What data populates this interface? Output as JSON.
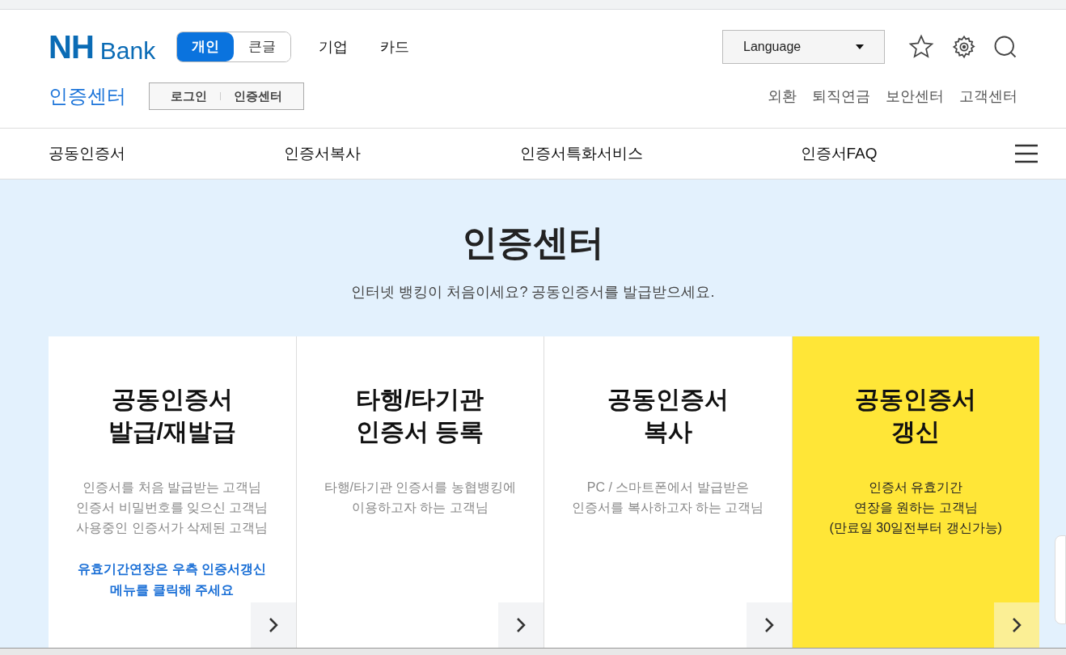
{
  "header": {
    "logo": {
      "mark": "NH",
      "word": "Bank"
    },
    "modes": [
      {
        "label": "개인",
        "selected": true
      },
      {
        "label": "큰글",
        "selected": false
      }
    ],
    "top_links": [
      "기업",
      "카드"
    ],
    "language": {
      "value": "Language"
    },
    "section_title": "인증센터",
    "breadcrumb": [
      "로그인",
      "인증센터"
    ],
    "util_links": [
      "외환",
      "퇴직연금",
      "보안센터",
      "고객센터"
    ]
  },
  "nav": [
    "공동인증서",
    "인증서복사",
    "인증서특화서비스",
    "인증서FAQ"
  ],
  "hero": {
    "title": "인증센터",
    "subtitle": "인터넷 뱅킹이 처음이세요? 공동인증서를 발급받으세요."
  },
  "cards": [
    {
      "title": [
        "공동인증서",
        "발급/재발급"
      ],
      "lines": [
        "인증서를 처음 발급받는 고객님",
        "인증서 비밀번호를 잊으신 고객님",
        "사용중인 인증서가 삭제된 고객님"
      ],
      "note": [
        "유효기간연장은 우측 인증서갱신",
        "메뉴를 클릭해 주세요"
      ],
      "selected": false
    },
    {
      "title": [
        "타행/타기관",
        "인증서 등록"
      ],
      "lines": [
        "타행/타기관 인증서를 농협뱅킹에",
        "이용하고자 하는 고객님"
      ],
      "selected": false
    },
    {
      "title": [
        "공동인증서",
        "복사"
      ],
      "lines": [
        "PC / 스마트폰에서 발급받은",
        "인증서를 복사하고자 하는 고객님"
      ],
      "selected": false
    },
    {
      "title": [
        "공동인증서",
        "갱신"
      ],
      "lines": [
        "인증서 유효기간",
        "연장을 원하는 고객님",
        "(만료일 30일전부터 갱신가능)"
      ],
      "selected": true
    }
  ]
}
